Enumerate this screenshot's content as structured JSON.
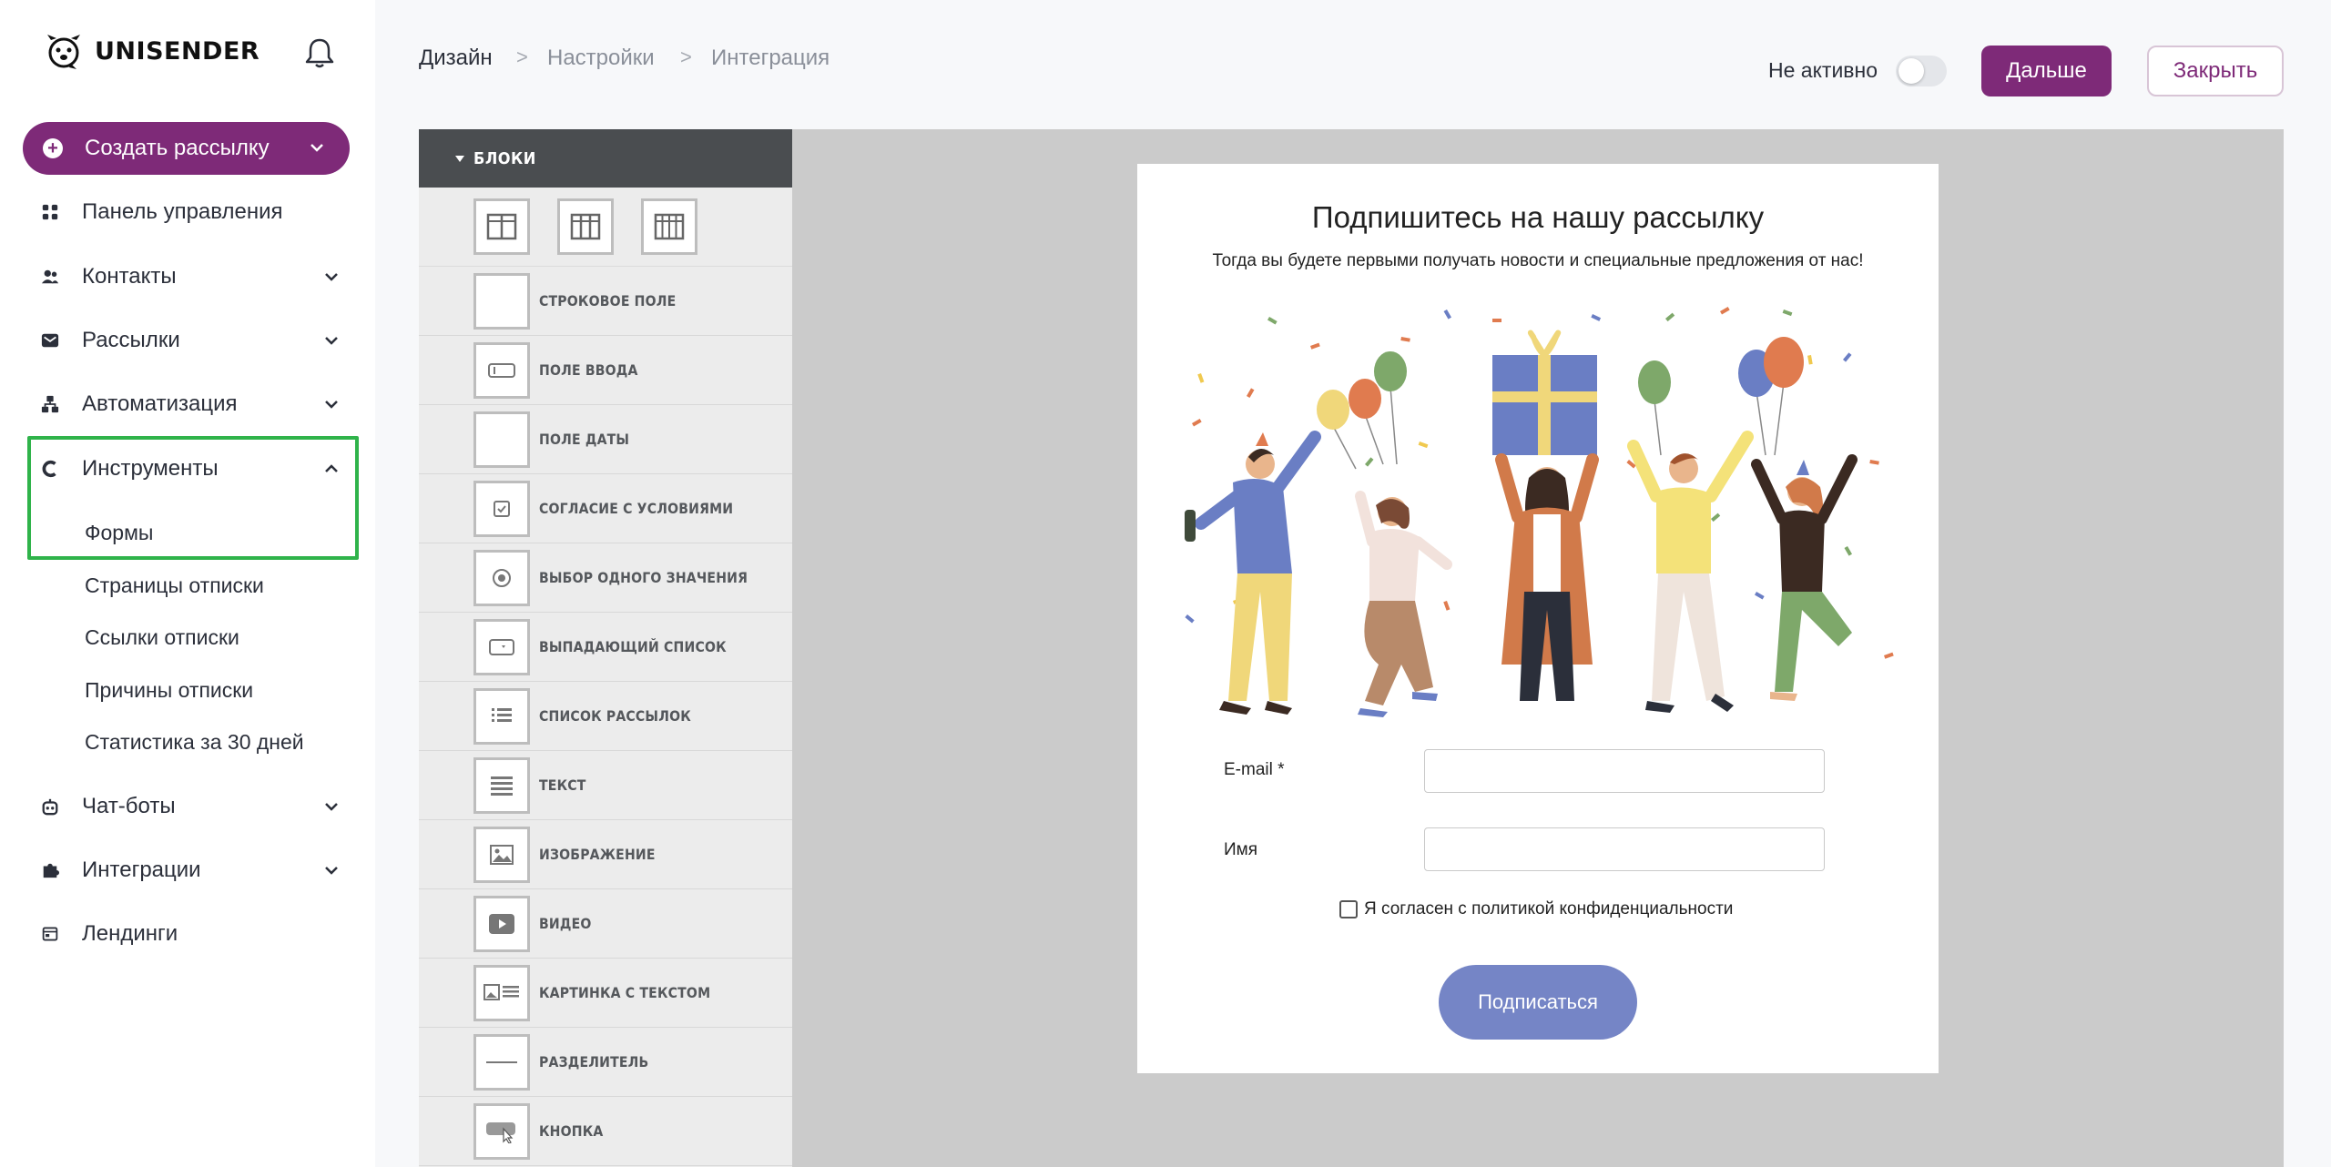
{
  "sidebar": {
    "logo_text": "UNISENDER",
    "create_button": "Создать рассылку",
    "nav": [
      {
        "label": "Панель управления",
        "icon": "dashboard-icon"
      },
      {
        "label": "Контакты",
        "icon": "contacts-icon"
      },
      {
        "label": "Рассылки",
        "icon": "mail-icon"
      },
      {
        "label": "Автоматизация",
        "icon": "automation-icon"
      },
      {
        "label": "Инструменты",
        "icon": "tools-icon"
      },
      {
        "label": "Чат-боты",
        "icon": "chatbot-icon"
      },
      {
        "label": "Интеграции",
        "icon": "puzzle-icon"
      },
      {
        "label": "Лендинги",
        "icon": "landing-icon"
      }
    ],
    "tools_sub": [
      "Формы",
      "Страницы отписки",
      "Ссылки отписки",
      "Причины отписки",
      "Статистика за 30 дней"
    ],
    "highlight_color": "#2fb34a"
  },
  "header": {
    "breadcrumbs": [
      "Дизайн",
      "Настройки",
      "Интеграция"
    ],
    "separator": ">",
    "status_label": "Не активно",
    "next_button": "Дальше",
    "close_button": "Закрыть",
    "accent_color": "#7e2a78"
  },
  "blocks": {
    "title": "БЛОКИ",
    "items": [
      "СТРОКОВОЕ ПОЛЕ",
      "ПОЛЕ ВВОДА",
      "ПОЛЕ ДАТЫ",
      "СОГЛАСИЕ С УСЛОВИЯМИ",
      "ВЫБОР ОДНОГО ЗНАЧЕНИЯ",
      "ВЫПАДАЮЩИЙ СПИСОК",
      "СПИСОК РАССЫЛОК",
      "ТЕКСТ",
      "ИЗОБРАЖЕНИЕ",
      "ВИДЕО",
      "КАРТИНКА С ТЕКСТОМ",
      "РАЗДЕЛИТЕЛЬ",
      "КНОПКА"
    ]
  },
  "form": {
    "title": "Подпишитесь на нашу рассылку",
    "subtitle": "Тогда вы будете первыми получать новости и специальные предложения от нас!",
    "email_label": "E-mail",
    "required_mark": "*",
    "name_label": "Имя",
    "consent": "Я согласен с политикой конфиденциальности",
    "submit": "Подписаться",
    "submit_color": "#7585c6"
  }
}
